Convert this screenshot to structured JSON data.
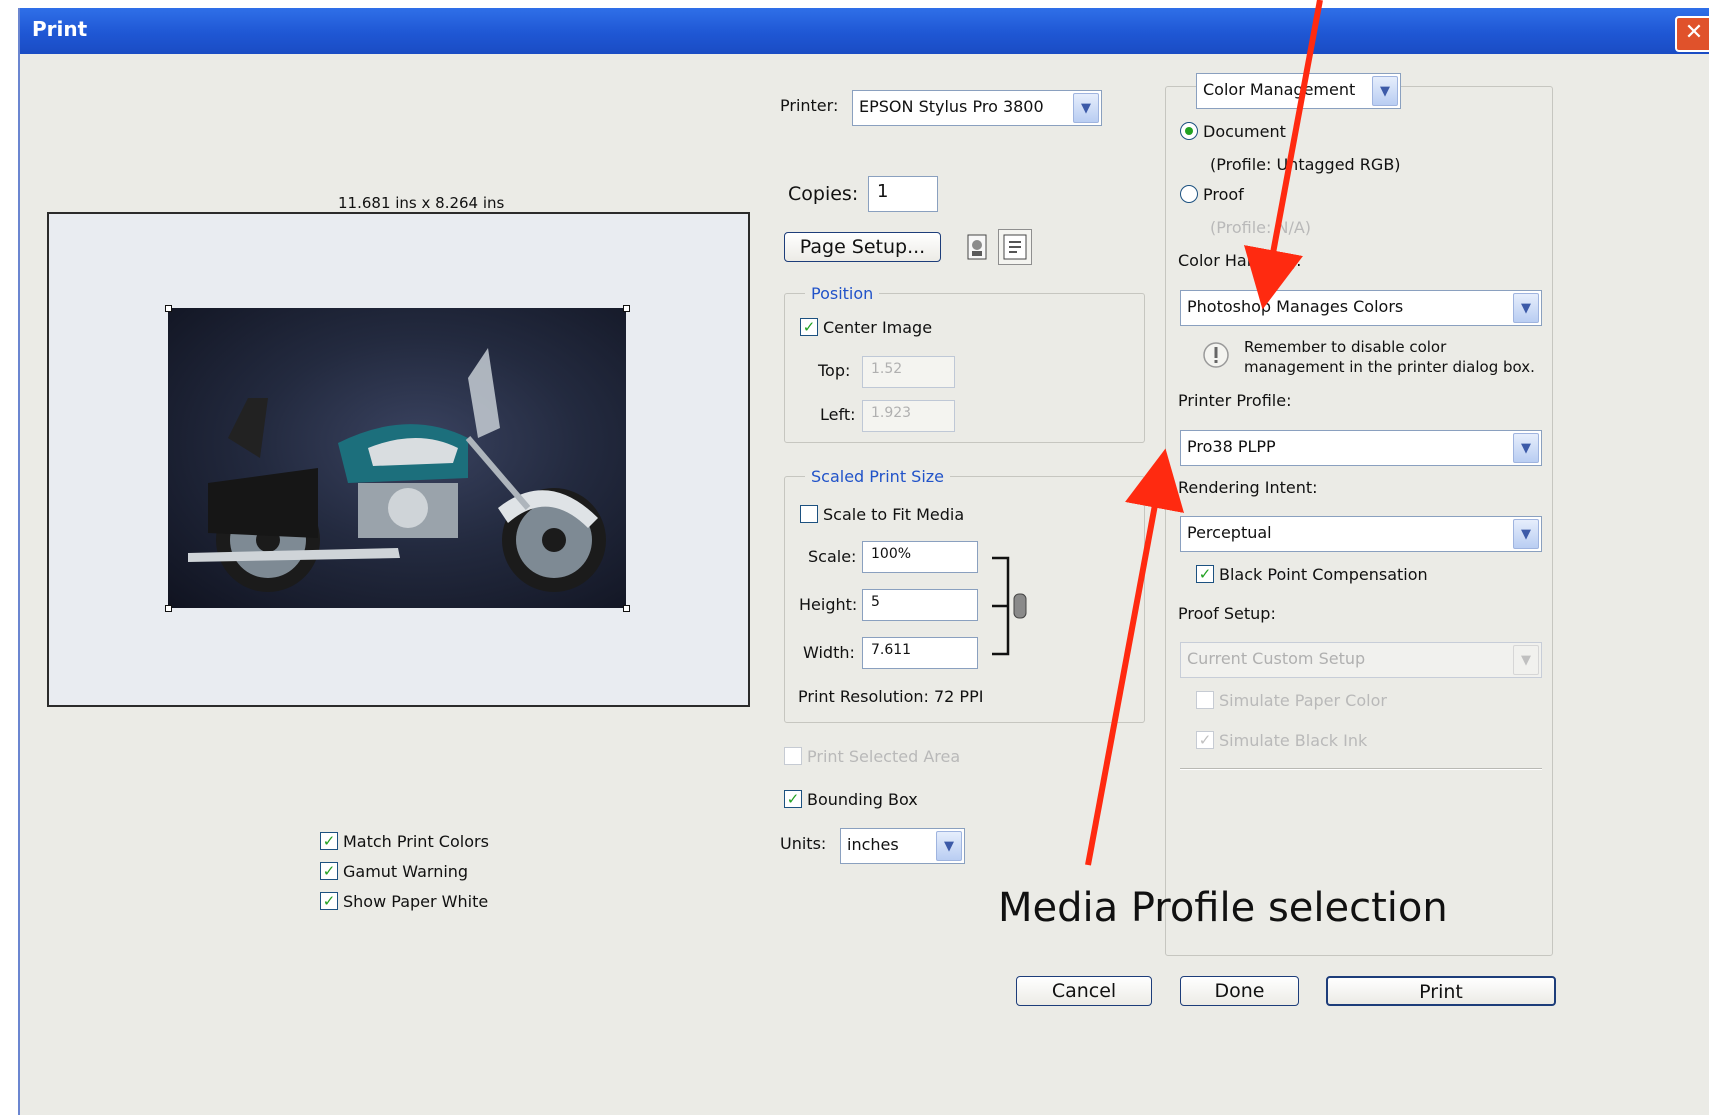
{
  "window": {
    "title": "Print",
    "close_glyph": "✕"
  },
  "preview": {
    "dimensions": "11.681 ins x 8.264 ins"
  },
  "printer": {
    "label": "Printer:",
    "value": "EPSON Stylus Pro 3800"
  },
  "copies": {
    "label": "Copies:",
    "value": "1"
  },
  "page_setup": {
    "label": "Page Setup..."
  },
  "position": {
    "title": "Position",
    "center_image": {
      "label": "Center Image",
      "checked": true
    },
    "top": {
      "label": "Top:",
      "value": "1.52"
    },
    "left": {
      "label": "Left:",
      "value": "1.923"
    }
  },
  "scaled": {
    "title": "Scaled Print Size",
    "scale_to_fit": {
      "label": "Scale to Fit Media",
      "checked": false
    },
    "scale": {
      "label": "Scale:",
      "value": "100%"
    },
    "height": {
      "label": "Height:",
      "value": "5"
    },
    "width": {
      "label": "Width:",
      "value": "7.611"
    },
    "resolution": "Print Resolution: 72 PPI"
  },
  "print_selected_area": {
    "label": "Print Selected Area",
    "checked": false
  },
  "bounding_box": {
    "label": "Bounding Box",
    "checked": true
  },
  "units": {
    "label": "Units:",
    "value": "inches"
  },
  "left_options": {
    "match_print_colors": "Match Print Colors",
    "gamut_warning": "Gamut Warning",
    "show_paper_white": "Show Paper White"
  },
  "color_mgmt": {
    "section_dropdown": "Color Management",
    "document": {
      "label": "Document",
      "profile": "(Profile: Untagged RGB)"
    },
    "proof": {
      "label": "Proof",
      "profile": "(Profile: N/A)"
    },
    "color_handling_label": "Color Handling:",
    "color_handling_value": "Photoshop Manages Colors",
    "reminder": "Remember to disable color management in the printer dialog box.",
    "printer_profile_label": "Printer Profile:",
    "printer_profile_value": "Pro38 PLPP",
    "rendering_intent_label": "Rendering Intent:",
    "rendering_intent_value": "Perceptual",
    "bpc_label": "Black Point Compensation",
    "proof_setup_label": "Proof Setup:",
    "proof_setup_value": "Current Custom Setup",
    "simulate_paper": "Simulate Paper Color",
    "simulate_black": "Simulate Black Ink"
  },
  "buttons": {
    "cancel": "Cancel",
    "done": "Done",
    "print": "Print"
  },
  "annotation": {
    "text": "Media Profile selection",
    "arrow_color": "#ff2a10"
  },
  "icons": {
    "info": "info-icon",
    "link": "link-chain-icon",
    "portrait": "portrait-orientation-icon",
    "landscape": "landscape-orientation-icon"
  },
  "check_glyph": "✓"
}
